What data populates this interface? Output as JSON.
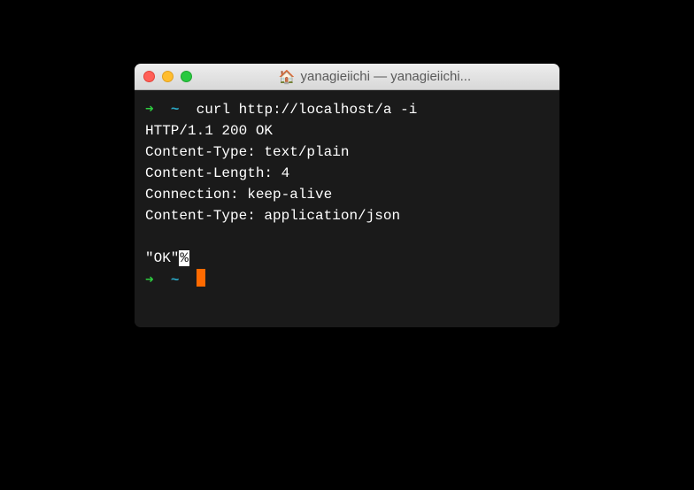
{
  "titlebar": {
    "home_icon": "🏠",
    "title": "yanagieiichi — yanagieiichi..."
  },
  "prompt": {
    "arrow": "➜",
    "tilde": "~"
  },
  "command": "curl http://localhost/a -i",
  "responses": [
    "HTTP/1.1 200 OK",
    "Content-Type: text/plain",
    "Content-Length: 4",
    "Connection: keep-alive",
    "Content-Type: application/json"
  ],
  "body_output": {
    "ok": "\"OK\"",
    "trailing": "%"
  }
}
